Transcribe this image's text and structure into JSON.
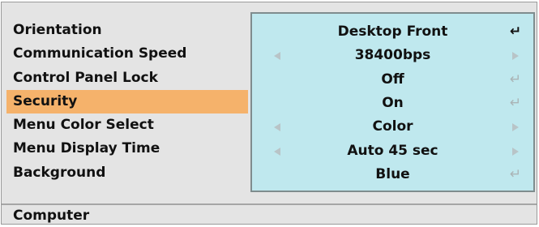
{
  "menu": {
    "items": [
      {
        "label": "Orientation",
        "value": "Desktop Front",
        "left_arrow": false,
        "right_arrow": false,
        "enter": "active",
        "selected": false
      },
      {
        "label": "Communication Speed",
        "value": "38400bps",
        "left_arrow": true,
        "right_arrow": true,
        "enter": "none",
        "selected": false
      },
      {
        "label": "Control Panel Lock",
        "value": "Off",
        "left_arrow": false,
        "right_arrow": false,
        "enter": "inactive",
        "selected": false
      },
      {
        "label": "Security",
        "value": "On",
        "left_arrow": false,
        "right_arrow": false,
        "enter": "inactive",
        "selected": true
      },
      {
        "label": "Menu Color Select",
        "value": "Color",
        "left_arrow": true,
        "right_arrow": true,
        "enter": "none",
        "selected": false
      },
      {
        "label": "Menu Display Time",
        "value": "Auto 45 sec",
        "left_arrow": true,
        "right_arrow": true,
        "enter": "none",
        "selected": false
      },
      {
        "label": "Background",
        "value": "Blue",
        "left_arrow": false,
        "right_arrow": false,
        "enter": "inactive",
        "selected": false
      }
    ]
  },
  "status_bar": {
    "source": "Computer"
  },
  "icons": {
    "enter": "↵",
    "left": "left-arrow-icon",
    "right": "right-arrow-icon"
  },
  "colors": {
    "selected_row": "#f5b26b",
    "value_panel": "#bfe8ee",
    "background": "#e4e4e4"
  }
}
